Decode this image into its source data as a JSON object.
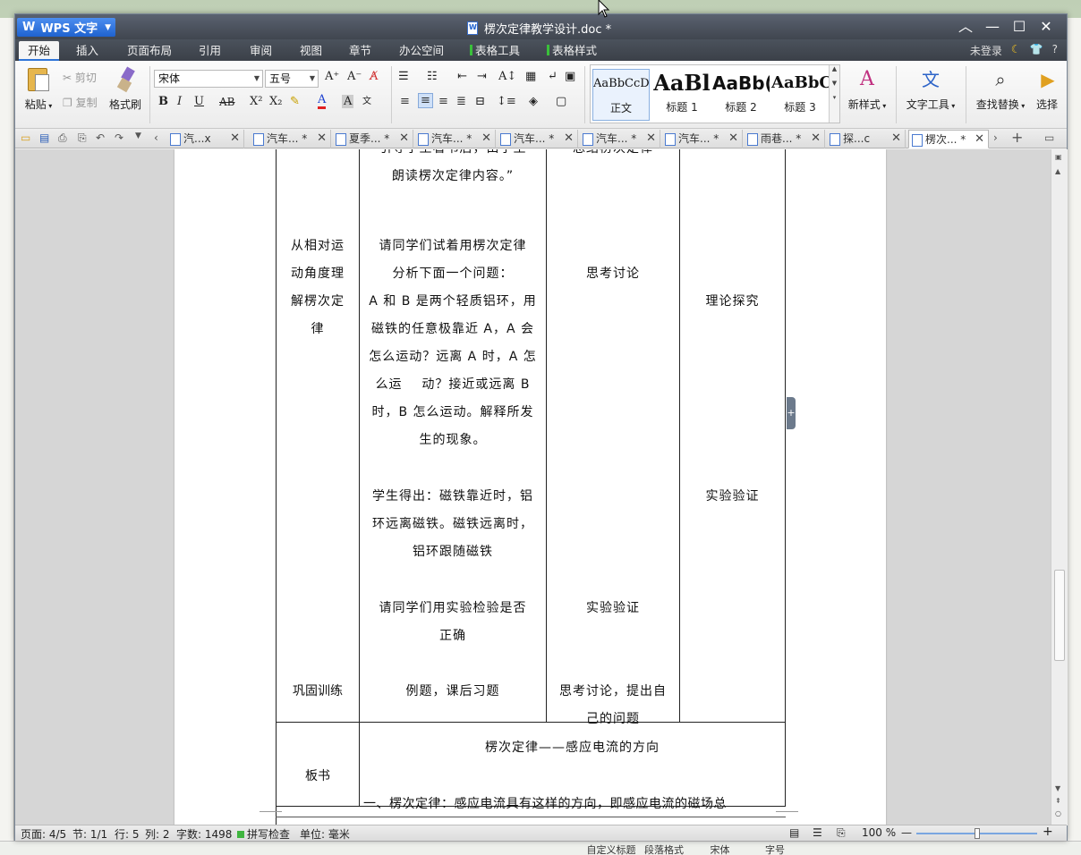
{
  "window": {
    "app_name": "WPS 文字",
    "doc_title": "楞次定律教学设计.doc *",
    "controls": [
      "︿",
      "—",
      "☐",
      "✕"
    ]
  },
  "ribbon_tabs": [
    "开始",
    "插入",
    "页面布局",
    "引用",
    "审阅",
    "视图",
    "章节",
    "办公空间",
    "表格工具",
    "表格样式"
  ],
  "account": {
    "login": "未登录",
    "help": "?"
  },
  "toolbar": {
    "paste": "粘贴",
    "cut": "剪切",
    "copy": "复制",
    "format_painter": "格式刷",
    "font_name": "宋体",
    "font_size": "五号",
    "bold": "B",
    "italic": "I",
    "underline": "U",
    "strike": "AB",
    "superscript": "X²",
    "subscript": "X₂",
    "new_style": "新样式",
    "text_tools": "文字工具",
    "find_replace": "查找替换",
    "select": "选择"
  },
  "styles": [
    {
      "sample": "AaBbCcDd",
      "label": "正文"
    },
    {
      "sample": "AaBl",
      "label": "标题 1"
    },
    {
      "sample": "AaBb(",
      "label": "标题 2"
    },
    {
      "sample": "AaBbC",
      "label": "标题 3"
    }
  ],
  "doc_tabs": [
    "汽...x",
    "汽车... *",
    "夏季... *",
    "汽车... *",
    "汽车... *",
    "汽车... *",
    "汽车... *",
    "雨巷... *",
    "探...c",
    "楞次... *"
  ],
  "document": {
    "row1": {
      "col2_top": "引导学生看书后，由学生",
      "col2_top2": "朗读楞次定律内容。”",
      "col3_top": "总结楞次定律"
    },
    "section_relative": {
      "col1": [
        "从相对运",
        "动角度理",
        "解楞次定",
        "律"
      ],
      "col2": [
        "请同学们试着用楞次定律",
        "分析下面一个问题：",
        "A 和 B 是两个轻质铝环，用",
        "磁铁的任意极靠近 A，A 会",
        "怎么运动？远离 A 时，A 怎",
        "么运    动？接近或远离 B",
        "时，B 怎么运动。解释所发",
        "生的现象。"
      ],
      "col3": "思考讨论",
      "col4": "理论探究"
    },
    "section_result": {
      "col2": [
        "学生得出：磁铁靠近时，铝",
        "环远离磁铁。磁铁远离时，",
        "铝环跟随磁铁"
      ],
      "col4": "实验验证"
    },
    "section_verify": {
      "col2": [
        "请同学们用实验检验是否",
        "正确"
      ],
      "col3": "实验验证"
    },
    "section_practice": {
      "col1": "巩固训练",
      "col2": "例题，课后习题",
      "col3": [
        "思考讨论，提出自",
        "己的问题"
      ]
    },
    "board": {
      "label": "板书",
      "title": "楞次定律——感应电流的方向",
      "line1": "一、楞次定律：感应电流具有这样的方向，即感应电流的磁场总"
    }
  },
  "status": {
    "page": "页面: 4/5",
    "section": "节: 1/1",
    "row": "行: 5",
    "col": "列: 2",
    "words": "字数: 1498",
    "spell": "拼写检查",
    "unit": "单位: 毫米",
    "zoom": "100 %"
  },
  "bottom_strip": [
    "自定义标题",
    "段落格式",
    "宋体",
    "字号"
  ]
}
